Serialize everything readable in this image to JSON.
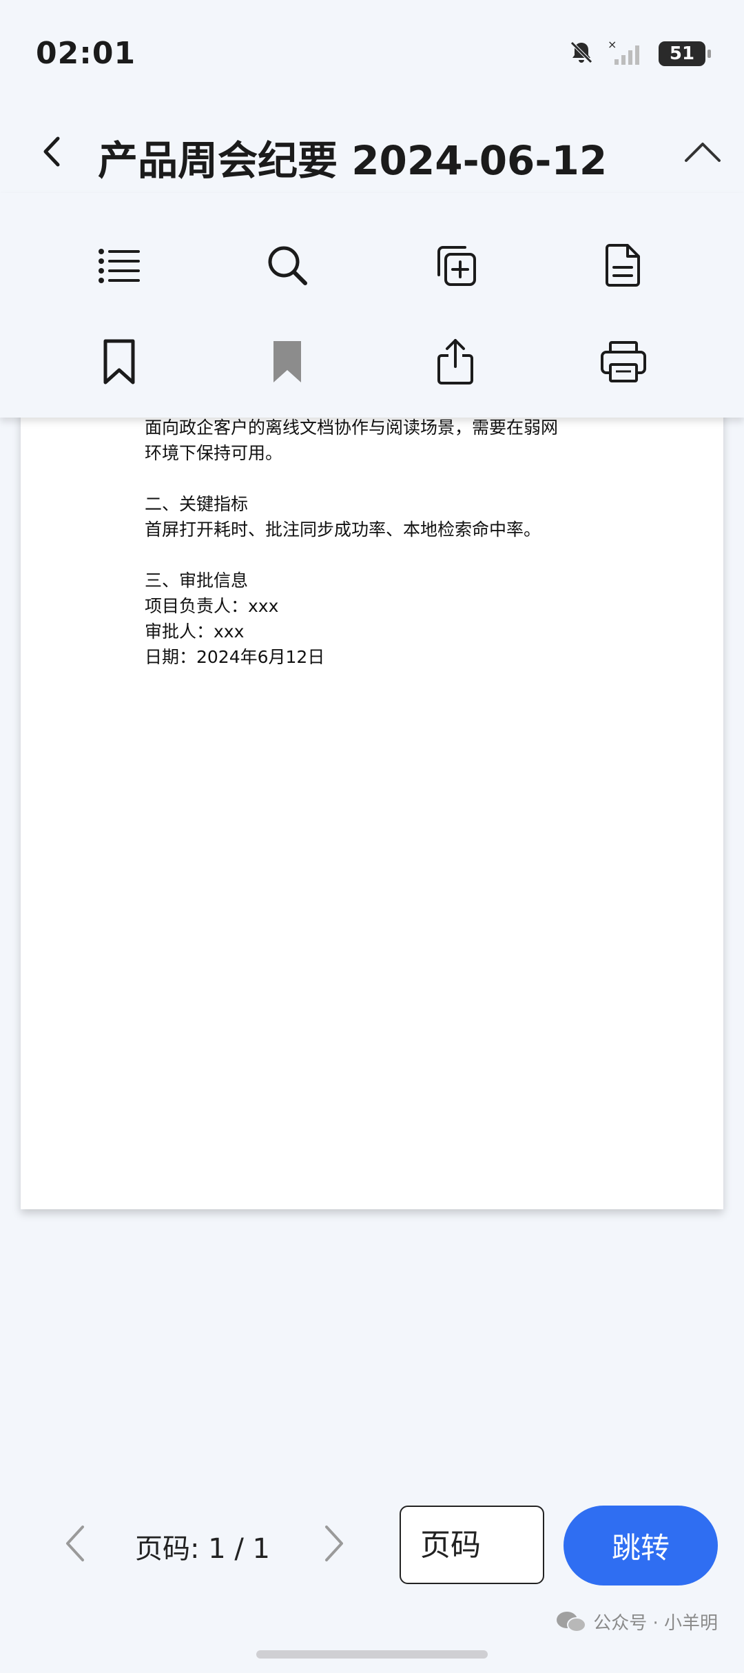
{
  "status_bar": {
    "time": "02:01",
    "battery_level": "51",
    "icons": [
      "bell-off-icon",
      "signal-no-service-icon",
      "battery-icon"
    ]
  },
  "header": {
    "title": "产品周会纪要 2024-06-12",
    "back_icon": "chevron-left-icon",
    "collapse_icon": "chevron-up-icon"
  },
  "toolbar": {
    "row1": [
      "list-icon",
      "search-icon",
      "copy-add-icon",
      "document-icon"
    ],
    "row2": [
      "bookmark-outline-icon",
      "bookmark-filled-icon",
      "share-icon",
      "print-icon"
    ]
  },
  "document": {
    "lines": [
      "面向政企客户的离线文档协作与阅读场景，需要在弱网",
      "环境下保持可用。",
      "",
      "二、关键指标",
      "首屏打开耗时、批注同步成功率、本地检索命中率。",
      "",
      "三、审批信息",
      "项目负责人：xxx",
      "审批人：xxx",
      "日期：2024年6月12日"
    ]
  },
  "pager": {
    "page_label": "页码: 1 / 1",
    "input_placeholder": "页码",
    "jump_label": "跳转",
    "accent_color": "#2f6ef2"
  },
  "watermark": {
    "text": "公众号 · 小羊明"
  }
}
